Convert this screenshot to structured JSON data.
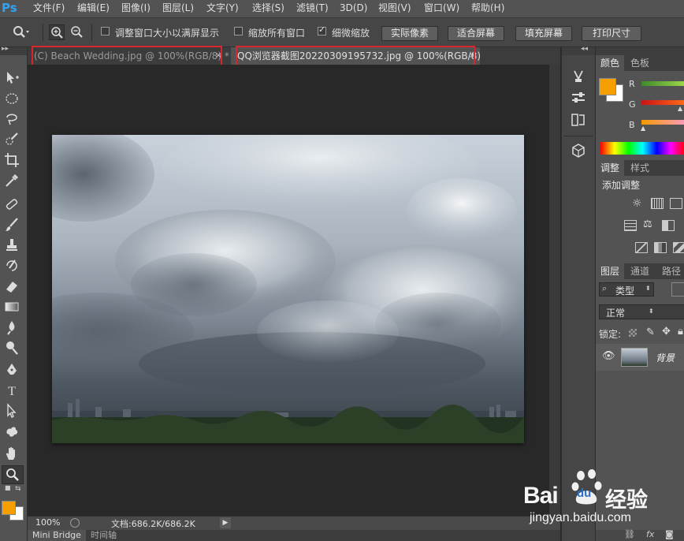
{
  "app": {
    "logo": "Ps"
  },
  "menu": [
    "文件(F)",
    "编辑(E)",
    "图像(I)",
    "图层(L)",
    "文字(Y)",
    "选择(S)",
    "滤镜(T)",
    "3D(D)",
    "视图(V)",
    "窗口(W)",
    "帮助(H)"
  ],
  "options": {
    "resize_windows": {
      "label": "调整窗口大小以满屏显示",
      "checked": false
    },
    "zoom_all_windows": {
      "label": "缩放所有窗口",
      "checked": false
    },
    "scrubby_zoom": {
      "label": "细微缩放",
      "checked": true
    },
    "buttons": [
      "实际像素",
      "适合屏幕",
      "填充屏幕",
      "打印尺寸"
    ]
  },
  "tabs": [
    {
      "title": "(C) Beach Wedding.jpg @ 100%(RGB/8) *",
      "close": "×",
      "active": false
    },
    {
      "title": "QQ浏览器截图20220309195732.jpg @ 100%(RGB/8)",
      "close": "×",
      "active": true
    }
  ],
  "status": {
    "zoom": "100%",
    "doc_info": "文档:686.2K/686.2K"
  },
  "bottom_tabs": [
    "Mini Bridge",
    "时间轴"
  ],
  "panels": {
    "color": {
      "tabs": [
        "颜色",
        "色板"
      ],
      "channels": [
        "R",
        "G",
        "B"
      ],
      "foreground": "#f5a000",
      "background": "#ffffff"
    },
    "adjustments": {
      "tabs": [
        "调整",
        "样式"
      ],
      "title": "添加调整"
    },
    "layers": {
      "tabs": [
        "图层",
        "通道",
        "路径"
      ],
      "filter": "类型",
      "blend_mode": "正常",
      "lock_label": "锁定:",
      "layer": {
        "name": "背景"
      }
    }
  },
  "watermark": {
    "brand": "Bai",
    "brand2": "du",
    "cn": "经验",
    "url": "jingyan.baidu.com"
  },
  "colors": {
    "accent_red": "#d9262c",
    "ps_blue": "#2fa3f6"
  }
}
